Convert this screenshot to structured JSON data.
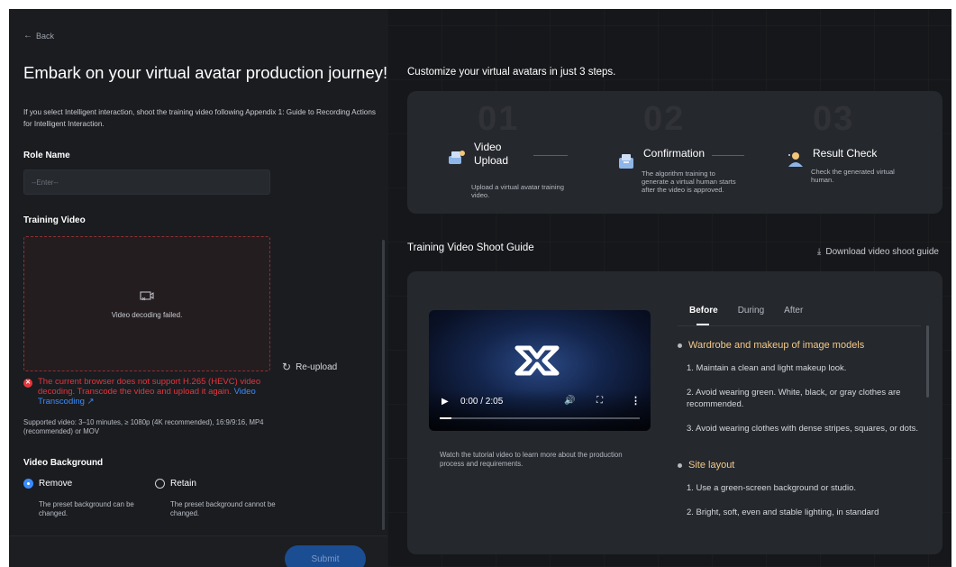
{
  "left": {
    "back_label": "Back",
    "title": "Embark on your virtual avatar production journey!",
    "note": "If you select Intelligent interaction, shoot the training video following Appendix 1: Guide to Recording Actions for Intelligent Interaction.",
    "role_name_label": "Role Name",
    "role_name_placeholder": "--Enter--",
    "training_video_label": "Training Video",
    "decode_failed": "Video decoding failed.",
    "reupload_label": "Re-upload",
    "error_text": "The current browser does not support H.265 (HEVC) video decoding. Transcode the video and upload it again.",
    "error_link": "Video Transcoding",
    "supported_text": "Supported video: 3–10 minutes, ≥ 1080p (4K recommended), 16:9/9:16, MP4 (recommended) or MOV",
    "background_label": "Video Background",
    "options": [
      {
        "label": "Remove",
        "desc": "The preset background can be changed.",
        "selected": true
      },
      {
        "label": "Retain",
        "desc": "The preset background cannot be changed.",
        "selected": false
      }
    ],
    "submit_label": "Submit"
  },
  "right": {
    "steps_title": "Customize your virtual avatars in just 3 steps.",
    "steps": [
      {
        "number": "01",
        "name": "Video Upload",
        "desc": "Upload a virtual avatar training video."
      },
      {
        "number": "02",
        "name": "Confirmation",
        "desc": "The algorithm training to generate a virtual human starts after the video is approved."
      },
      {
        "number": "03",
        "name": "Result Check",
        "desc": "Check the generated virtual human."
      }
    ],
    "guide_title": "Training Video Shoot Guide",
    "download_label": "Download video shoot guide",
    "video": {
      "time": "0:00 / 2:05",
      "progress": 0.06
    },
    "video_caption": "Watch the tutorial video to learn more about the production process and requirements.",
    "tabs": [
      "Before",
      "During",
      "After"
    ],
    "active_tab": "Before",
    "sections": [
      {
        "heading": "Wardrobe and makeup of image models",
        "items": [
          "1. Maintain a clean and light makeup look.",
          "2. Avoid wearing green. White, black, or gray clothes are recommended.",
          "3. Avoid wearing clothes with dense stripes, squares, or dots."
        ]
      },
      {
        "heading": "Site layout",
        "items": [
          "1. Use a green-screen background or studio.",
          "2. Bright, soft, even and stable lighting, in standard"
        ]
      }
    ]
  },
  "colors": {
    "error": "#e5363d",
    "link": "#3b8cff",
    "accent_heading": "#f3c98a",
    "submit_bg": "#1b4d93"
  }
}
